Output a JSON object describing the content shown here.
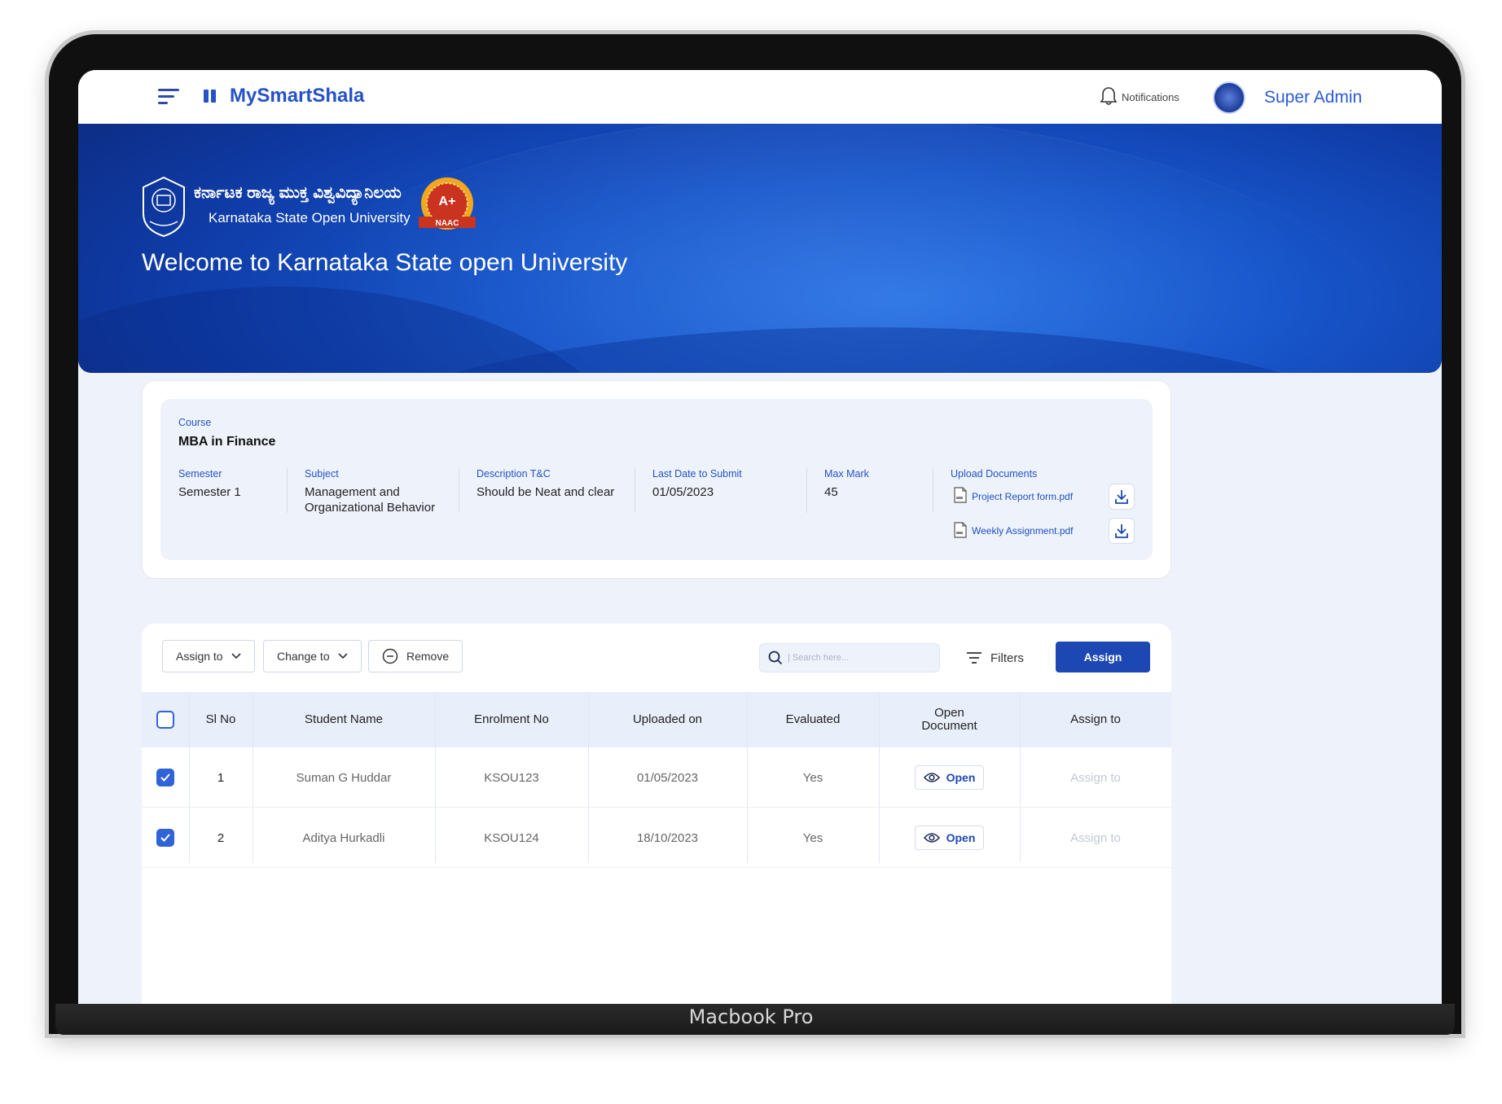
{
  "device": {
    "label": "Macbook Pro"
  },
  "app": {
    "name": "MySmartShala"
  },
  "topbar": {
    "notifications_label": "Notifications",
    "user_name": "Super Admin"
  },
  "hero": {
    "university_name_kn": "ಕರ್ನಾಟಕ ರಾಜ್ಯ ಮುಕ್ತ ವಿಶ್ವವಿದ್ಯಾನಿಲಯ",
    "university_name_en": "Karnataka State Open University",
    "badge_grade": "A+",
    "badge_label": "NAAC",
    "welcome_title": "Welcome to Karnataka State open University"
  },
  "course": {
    "course_label": "Course",
    "course_value": "MBA in Finance",
    "semester_label": "Semester",
    "semester_value": "Semester 1",
    "subject_label": "Subject",
    "subject_value_line1": "Management and",
    "subject_value_line2": "Organizational Behavior",
    "description_label": "Description T&C",
    "description_value": "Should be Neat and clear",
    "last_date_label": "Last Date to Submit",
    "last_date_value": "01/05/2023",
    "max_mark_label": "Max Mark",
    "max_mark_value": "45",
    "upload_label": "Upload Documents",
    "documents": [
      "Project Report form.pdf",
      "Weekly Assignment.pdf"
    ]
  },
  "toolbar": {
    "assign_to_label": "Assign to",
    "change_to_label": "Change to",
    "remove_label": "Remove",
    "search_placeholder": "| Search here...",
    "filters_label": "Filters",
    "assign_label": "Assign"
  },
  "table": {
    "headers": {
      "sl_no": "Sl No",
      "student_name": "Student Name",
      "enrolment_no": "Enrolment No",
      "uploaded_on": "Uploaded on",
      "evaluated": "Evaluated",
      "open_document_line1": "Open",
      "open_document_line2": "Document",
      "assign_to": "Assign to"
    },
    "rows": [
      {
        "checked": true,
        "sl_no": "1",
        "student_name": "Suman G Huddar",
        "enrolment_no": "KSOU123",
        "uploaded_on": "01/05/2023",
        "evaluated": "Yes",
        "open_label": "Open",
        "assign_to": "Assign to"
      },
      {
        "checked": true,
        "sl_no": "2",
        "student_name": "Aditya Hurkadli",
        "enrolment_no": "KSOU124",
        "uploaded_on": "18/10/2023",
        "evaluated": "Yes",
        "open_label": "Open",
        "assign_to": "Assign to"
      }
    ]
  },
  "colors": {
    "primary": "#1d47b3",
    "accent": "#2552c9",
    "hero_blue": "#1857cc",
    "page_bg": "#eef3fb"
  },
  "icons": [
    "menu-icon",
    "app-logo-icon",
    "bell-icon",
    "avatar",
    "chevron-down-icon",
    "minus-circle-icon",
    "search-icon",
    "filter-icon",
    "pdf-file-icon",
    "download-icon",
    "checkbox-icon",
    "eye-icon"
  ]
}
